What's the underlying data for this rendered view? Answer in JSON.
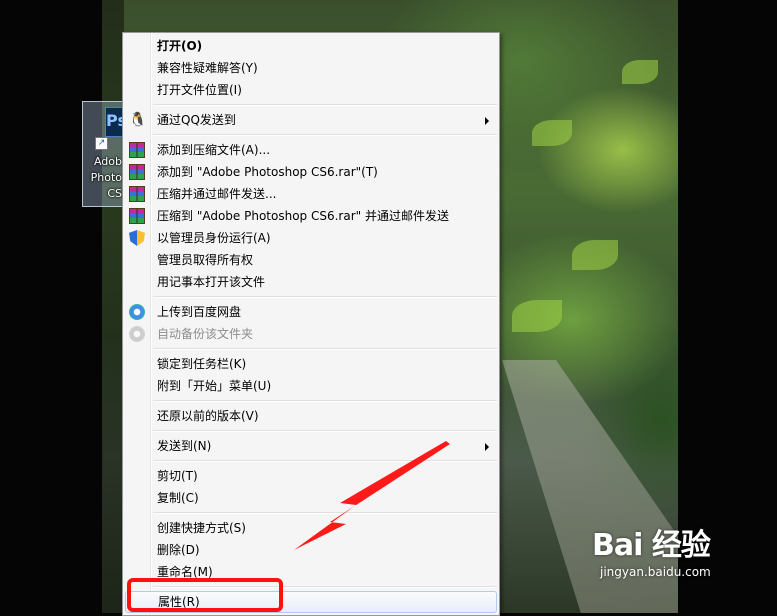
{
  "desktop_icon": {
    "label_lines": [
      "Adob",
      "Photo",
      "CS"
    ],
    "tile_text": "Ps"
  },
  "context_menu": {
    "items": [
      {
        "label": "打开(O)",
        "icon": "",
        "bold": true
      },
      {
        "label": "兼容性疑难解答(Y)",
        "icon": ""
      },
      {
        "label": "打开文件位置(I)",
        "icon": ""
      },
      {
        "label": "通过QQ发送到",
        "icon": "qq-penguin-icon",
        "submenu": true
      },
      {
        "label": "添加到压缩文件(A)...",
        "icon": "winrar-icon"
      },
      {
        "label": "添加到 \"Adobe Photoshop CS6.rar\"(T)",
        "icon": "winrar-icon"
      },
      {
        "label": "压缩并通过邮件发送...",
        "icon": "winrar-icon"
      },
      {
        "label": "压缩到 \"Adobe Photoshop CS6.rar\" 并通过邮件发送",
        "icon": "winrar-icon"
      },
      {
        "label": "以管理员身份运行(A)",
        "icon": "uac-shield-icon"
      },
      {
        "label": "管理员取得所有权",
        "icon": ""
      },
      {
        "label": "用记事本打开该文件",
        "icon": ""
      },
      {
        "label": "上传到百度网盘",
        "icon": "baidu-cloud-icon"
      },
      {
        "label": "自动备份该文件夹",
        "icon": "baidu-cloud-icon",
        "disabled": true
      },
      {
        "label": "锁定到任务栏(K)",
        "icon": ""
      },
      {
        "label": "附到「开始」菜单(U)",
        "icon": ""
      },
      {
        "label": "还原以前的版本(V)",
        "icon": ""
      },
      {
        "label": "发送到(N)",
        "icon": "",
        "submenu": true
      },
      {
        "label": "剪切(T)",
        "icon": ""
      },
      {
        "label": "复制(C)",
        "icon": ""
      },
      {
        "label": "创建快捷方式(S)",
        "icon": ""
      },
      {
        "label": "删除(D)",
        "icon": ""
      },
      {
        "label": "重命名(M)",
        "icon": ""
      },
      {
        "label": "属性(R)",
        "icon": "",
        "highlighted": true
      }
    ]
  },
  "annotation": {
    "arrow_color": "#ff1a1a",
    "box_color": "#ff1111"
  },
  "watermark": {
    "logo": "Bai  经验",
    "url": "jingyan.baidu.com"
  }
}
